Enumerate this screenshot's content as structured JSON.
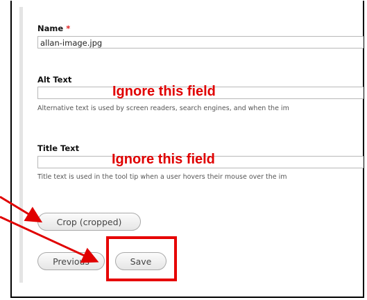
{
  "form": {
    "name_label": "Name",
    "required_marker": "*",
    "name_value": "allan-image.jpg",
    "alt_label": "Alt Text",
    "alt_value": "",
    "alt_description": "Alternative text is used by screen readers, search engines, and when the im",
    "title_label": "Title Text",
    "title_value": "",
    "title_description": "Title text is used in the tool tip when a user hovers their mouse over the im"
  },
  "annotations": {
    "ignore_alt": "Ignore this field",
    "ignore_title": "Ignore this field",
    "color": "#e00000"
  },
  "buttons": {
    "crop": "Crop (cropped)",
    "previous": "Previous",
    "save": "Save"
  }
}
